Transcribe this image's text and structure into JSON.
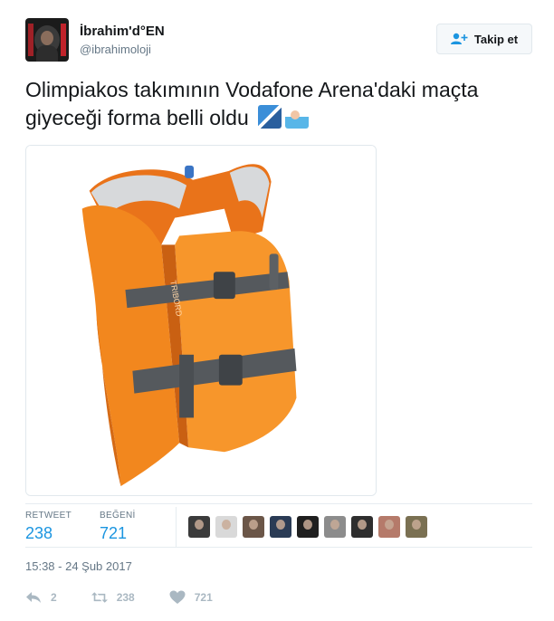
{
  "user": {
    "display_name": "İbrahim'd°EN",
    "handle": "@ibrahimoloji"
  },
  "follow_button": {
    "label": "Takip et",
    "icon": "user-plus-icon"
  },
  "tweet": {
    "text": "Olimpiakos takımının Vodafone Arena'daki maçta giyeceği forma belli oldu",
    "emojis": [
      "flag-emoji",
      "swimmer-emoji"
    ]
  },
  "media": {
    "subject": "orange life vest",
    "vest_brand": "TRIBORD"
  },
  "stats": {
    "retweet_label": "RETWEET",
    "retweet_count": "238",
    "like_label": "BEĞENİ",
    "like_count": "721",
    "liker_avatar_count": 9
  },
  "timestamp": "15:38 - 24 Şub 2017",
  "actions": {
    "reply_count": "2",
    "retweet_count": "238",
    "like_count": "721"
  },
  "colors": {
    "accent": "#1b95e0",
    "muted": "#657786",
    "icon": "#aab8c2",
    "vest_orange": "#f2871e"
  }
}
